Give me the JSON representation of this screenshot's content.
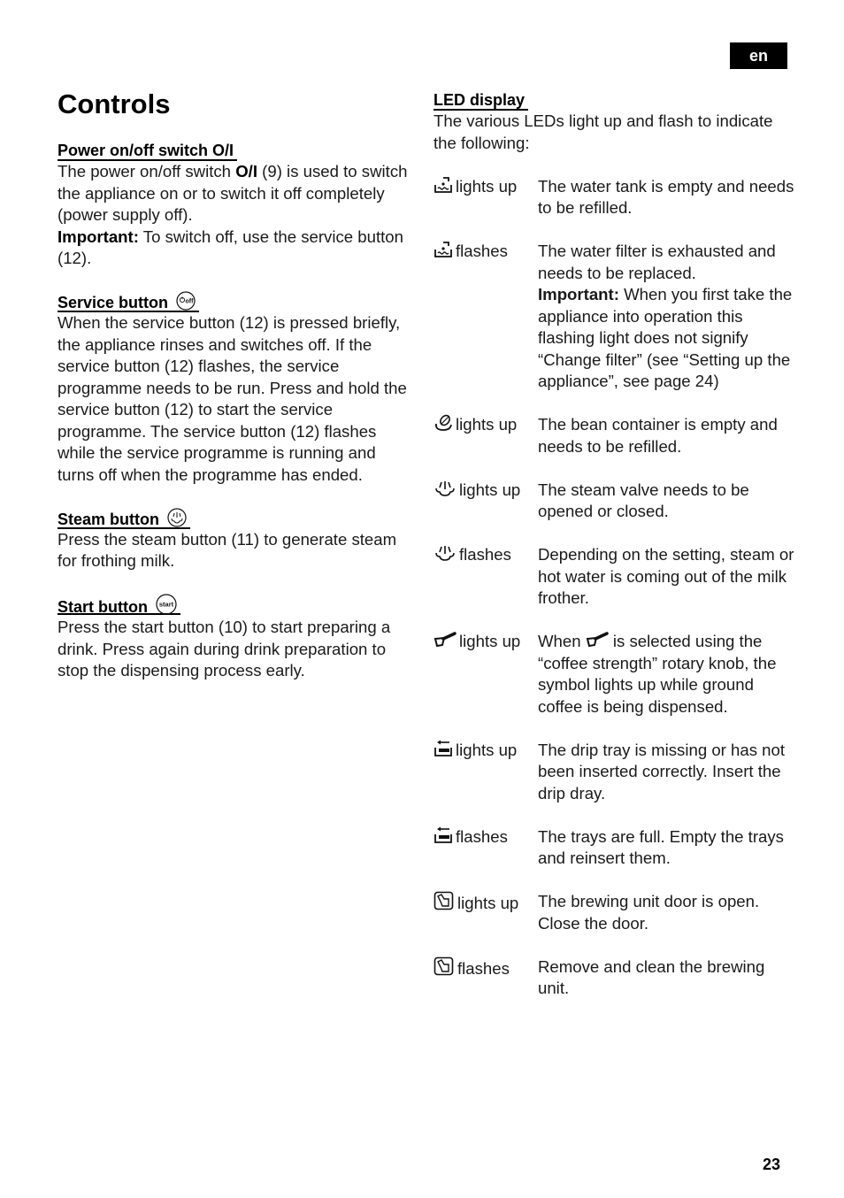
{
  "page": {
    "language_tab": "en",
    "page_number": "23",
    "title": "Controls"
  },
  "left_column": {
    "power": {
      "heading": "Power on/off switch O/I",
      "p1_a": "The power on/off switch ",
      "p1_symbol": "O/I",
      "p1_b": " (9) is used to switch the appliance on or to switch it off completely (power supply off).",
      "important_label": "Important:",
      "important_text": " To switch off, use the service button (12)."
    },
    "service": {
      "heading": "Service button",
      "icon": "service-off-icon",
      "text": "When the service button (12) is pressed briefly, the appliance rinses and switches off. If the service button (12) flashes, the service programme needs to be run. Press and hold the service button (12) to start the service programme. The service button (12) flashes while the service programme is running and turns off when the programme has ended."
    },
    "steam": {
      "heading": "Steam button",
      "icon": "steam-icon",
      "text": "Press the steam button (11) to generate steam for frothing milk."
    },
    "start": {
      "heading": "Start button",
      "icon": "start-icon",
      "icon_label": "start",
      "text": "Press the start button (10) to start preparing a drink. Press again during drink preparation to stop the dispensing process early."
    }
  },
  "right_column": {
    "heading": "LED display",
    "intro": "The various LEDs light up and flash to indicate the following:",
    "entries": [
      {
        "icon": "water-tank-icon",
        "state": "lights up",
        "description": "The water tank is empty and needs to be refilled."
      },
      {
        "icon": "water-tank-icon",
        "state": "flashes",
        "description_a": "The water filter is exhausted and needs to be replaced.",
        "important_label": "Important:",
        "description_b": " When you first take the appliance into operation this flashing light does not signify “Change filter” (see “Setting up the appliance”, see page 24)"
      },
      {
        "icon": "bean-container-icon",
        "state": "lights up",
        "description": "The bean container is empty and needs to be refilled."
      },
      {
        "icon": "steam-valve-icon",
        "state": "lights up",
        "description": "The steam valve needs to be opened or closed."
      },
      {
        "icon": "steam-valve-icon",
        "state": "flashes",
        "description": "Depending on the setting, steam or hot water is coming out of the milk frother."
      },
      {
        "icon": "ground-coffee-scoop-icon",
        "state": "lights up",
        "description_a": "When ",
        "description_b": " is selected using the “coffee strength” rotary knob, the symbol lights up while ground coffee is being dispensed."
      },
      {
        "icon": "drip-tray-icon",
        "state": "lights up",
        "description": "The drip tray is missing or has not been inserted correctly. Insert the drip dray."
      },
      {
        "icon": "drip-tray-icon",
        "state": "flashes",
        "description": "The trays are full. Empty the trays and reinsert them."
      },
      {
        "icon": "brewing-unit-door-icon",
        "state": "lights up",
        "description": "The brewing unit door is open. Close the door."
      },
      {
        "icon": "brewing-unit-door-icon",
        "state": "flashes",
        "description": "Remove and clean the brewing unit."
      }
    ]
  }
}
